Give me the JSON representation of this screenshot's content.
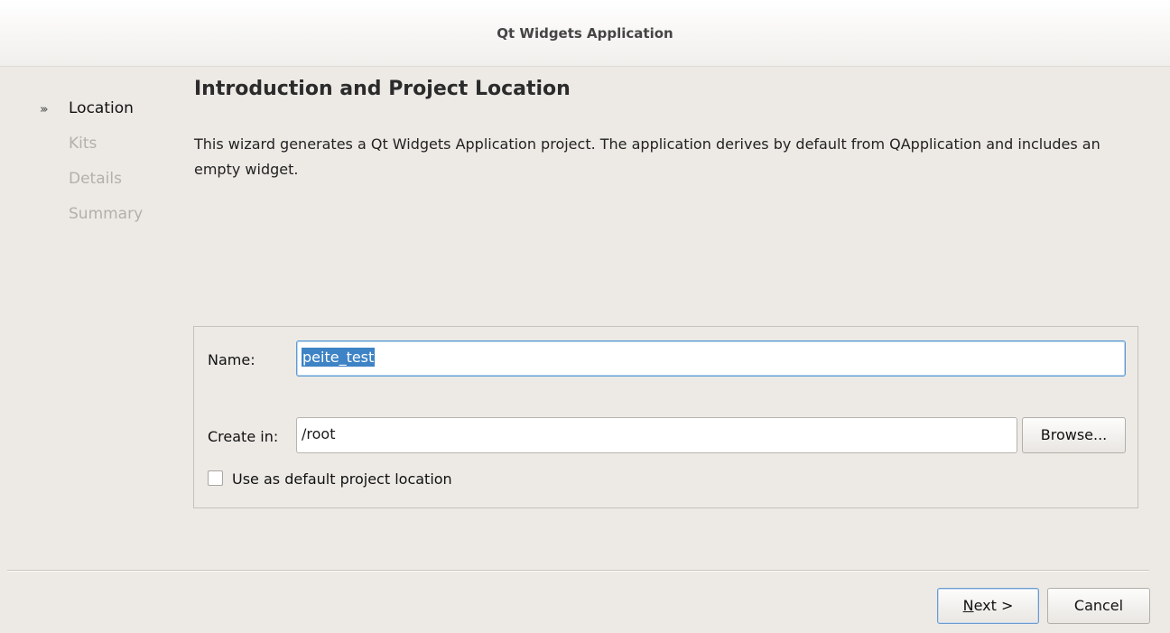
{
  "window": {
    "title": "Qt Widgets Application"
  },
  "steps": [
    {
      "label": "Location",
      "active": true
    },
    {
      "label": "Kits",
      "active": false
    },
    {
      "label": "Details",
      "active": false
    },
    {
      "label": "Summary",
      "active": false
    }
  ],
  "page": {
    "heading": "Introduction and Project Location",
    "description": "This wizard generates a Qt Widgets Application project. The application derives by default from QApplication and includes an empty widget."
  },
  "form": {
    "name_label": "Name:",
    "name_value": "peite_test",
    "create_in_label": "Create in:",
    "create_in_value": "/root",
    "browse_label": "Browse...",
    "default_location_label": "Use as default project location",
    "default_location_checked": false
  },
  "footer": {
    "next_label": "Next >",
    "cancel_label": "Cancel"
  },
  "colors": {
    "background": "#edeae6",
    "selection": "#3d83c5",
    "focus_border": "#5b9bd5"
  }
}
